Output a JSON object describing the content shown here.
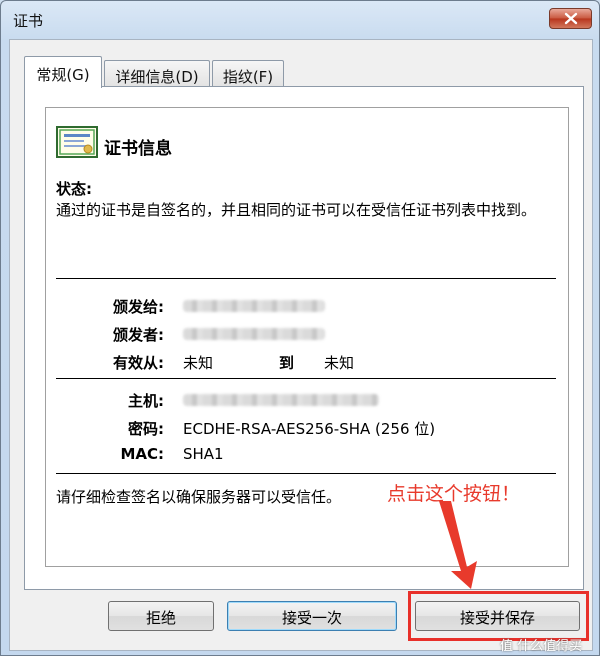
{
  "window": {
    "title": "证书"
  },
  "tabs": [
    {
      "label": "常规(G)"
    },
    {
      "label": "详细信息(D)"
    },
    {
      "label": "指纹(F)"
    }
  ],
  "cert_info": {
    "heading": "证书信息",
    "status_label": "状态:",
    "status_text": "通过的证书是自签名的，并且相同的证书可以在受信任证书列表中找到。"
  },
  "fields": {
    "issued_to_label": "颁发给:",
    "issued_by_label": "颁发者:",
    "valid_from_label": "有效从:",
    "valid_from_value": "未知",
    "to_label": "到",
    "valid_to_value": "未知",
    "host_label": "主机:",
    "cipher_label": "密码:",
    "cipher_value": "ECDHE-RSA-AES256-SHA (256 位)",
    "mac_label": "MAC:",
    "mac_value": "SHA1"
  },
  "tip_text": "请仔细检查签名以确保服务器可以受信任。",
  "buttons": {
    "reject": "拒绝",
    "accept_once": "接受一次",
    "accept_save": "接受并保存"
  },
  "annotation": {
    "text": "点击这个按钮！",
    "color": "#e83a2c"
  },
  "watermark": "值 什么值得买"
}
